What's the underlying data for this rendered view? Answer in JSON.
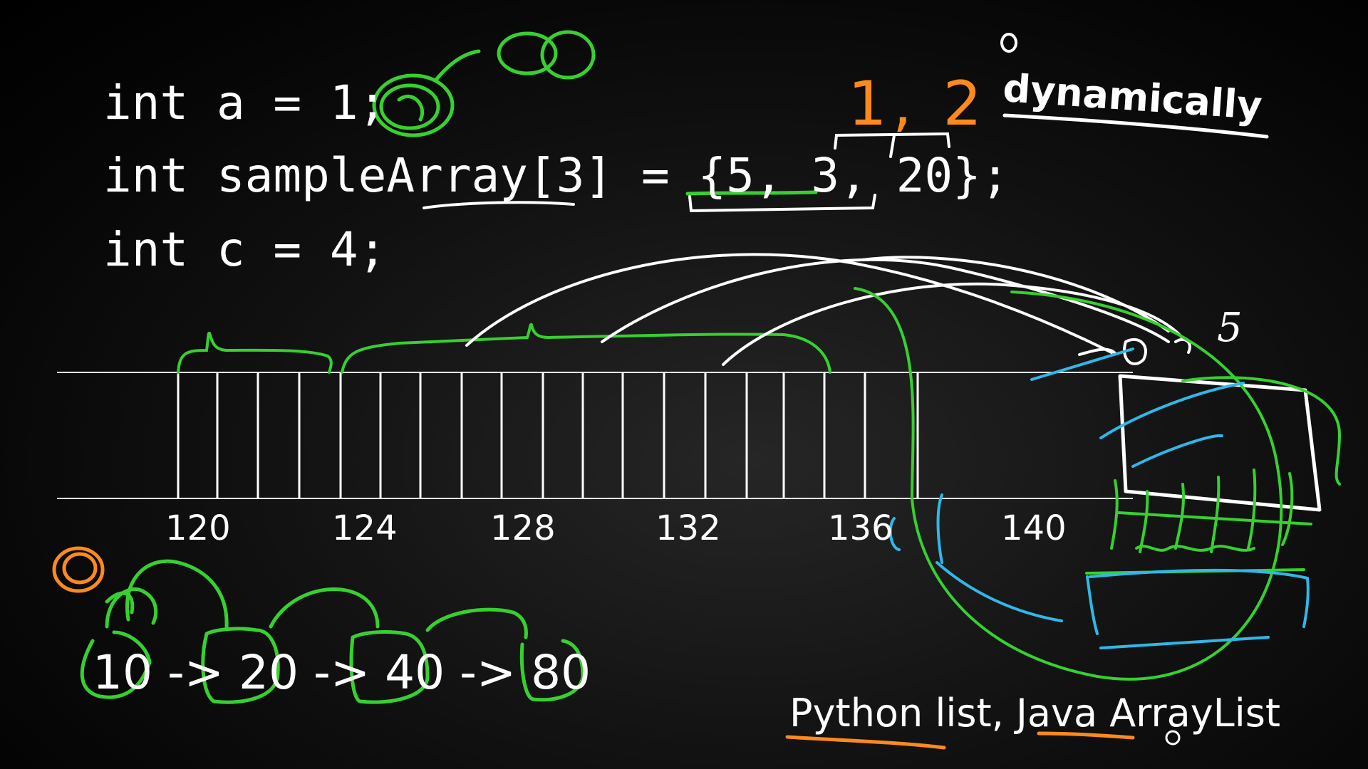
{
  "code": {
    "line1": "int a = 1;",
    "line2": "int sampleArray[3] = {5, 3, 20};",
    "line3": "int c = 4;"
  },
  "annotations": {
    "dynamically": "dynamically",
    "values": "1, 2",
    "five": "5"
  },
  "memory": {
    "addresses": [
      "120",
      "124",
      "128",
      "132",
      "136",
      "140"
    ]
  },
  "linked_list": {
    "text": "10 -> 20 -> 40 -> 80"
  },
  "caption": {
    "text": "Python list, Java ArrayList"
  },
  "colors": {
    "background": "#000000",
    "chalk_white": "#ffffff",
    "green_marker": "#36d12f",
    "orange_marker": "#ff8a1c",
    "blue_marker": "#2fb8e8"
  }
}
